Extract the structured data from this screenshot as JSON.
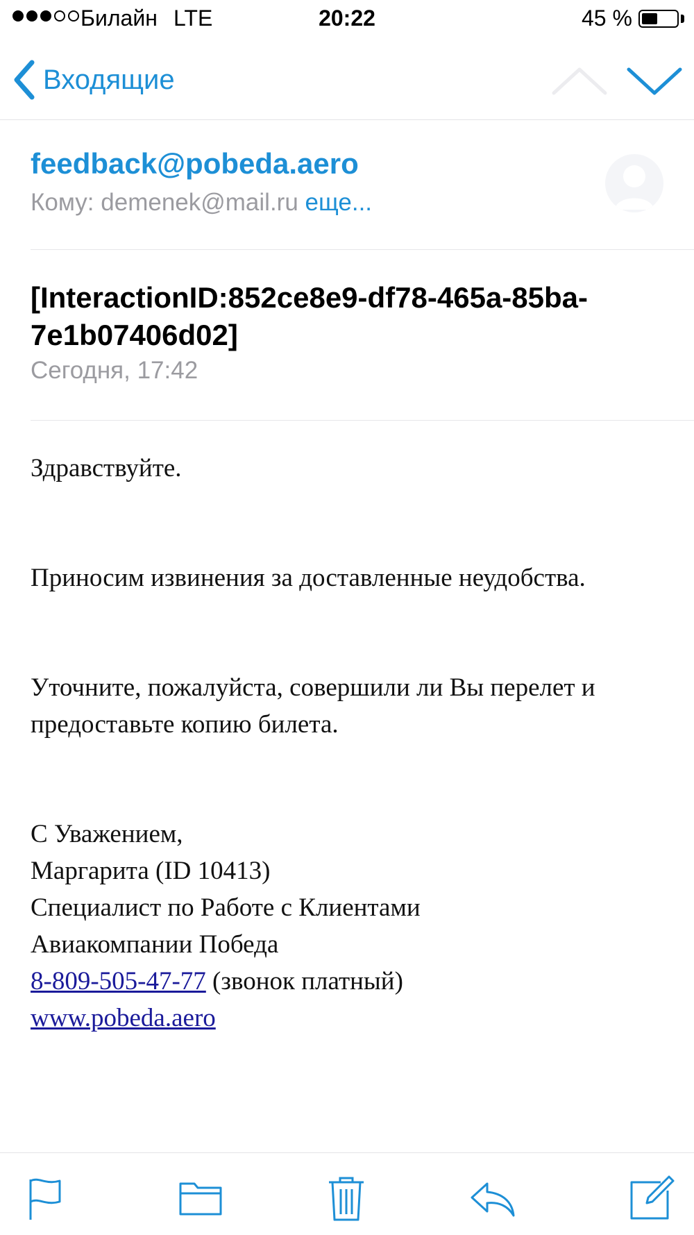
{
  "status_bar": {
    "carrier": "Билайн",
    "network": "LTE",
    "time": "20:22",
    "battery_percent": "45 %",
    "battery_level": 0.45,
    "signal_bars_filled": 3,
    "signal_bars_total": 5
  },
  "nav": {
    "back_label": "Входящие"
  },
  "header": {
    "sender": "feedback@pobeda.aero",
    "to_label": "Кому: ",
    "to_address": "demenek@mail.ru",
    "more_label": " еще..."
  },
  "subject": {
    "text": "[InteractionID:852ce8e9-df78-465a-85ba-7e1b07406d02]",
    "date": "Сегодня, 17:42"
  },
  "body": {
    "greeting": "Здравствуйте.",
    "apology": "Приносим извинения за доставленные неудобства.",
    "request": "Уточните, пожалуйста, совершили ли Вы перелет и предоставьте копию билета.",
    "signature": {
      "regards": "С Уважением,",
      "name": "Маргарита (ID 10413)",
      "position": "Специалист по Работе с Клиентами",
      "company": "Авиакомпании Победа",
      "phone": "8-809-505-47-77",
      "phone_note": " (звонок платный)",
      "website": "www.pobeda.aero"
    }
  },
  "colors": {
    "accent": "#1d8fd6",
    "secondary_text": "#9b9ba0",
    "link": "#1a1a9a",
    "separator": "#e6e6e9"
  },
  "toolbar": {
    "icons": [
      "flag-icon",
      "folder-icon",
      "trash-icon",
      "reply-icon",
      "compose-icon"
    ]
  }
}
